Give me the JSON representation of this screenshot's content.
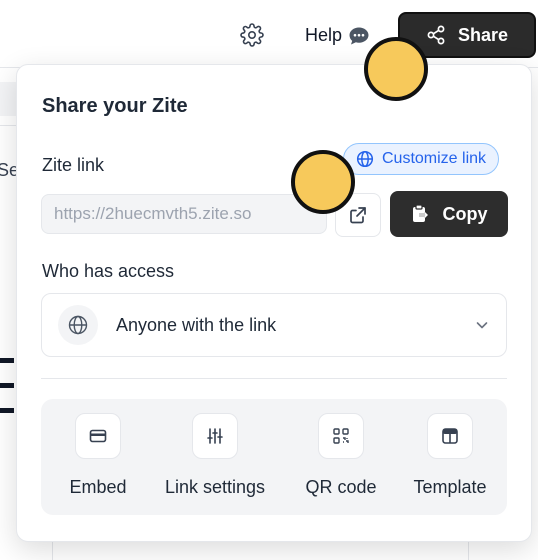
{
  "topbar": {
    "help_label": "Help",
    "share_label": "Share"
  },
  "background": {
    "fragment_text": "Se"
  },
  "share_panel": {
    "title": "Share your Zite",
    "link_section": {
      "label": "Zite link",
      "customize_label": "Customize link",
      "url_placeholder": "https://2huecmvth5.zite.so",
      "copy_label": "Copy"
    },
    "access_section": {
      "label": "Who has access",
      "selected_option": "Anyone with the link"
    },
    "options": [
      {
        "label": "Embed",
        "icon": "embed-icon"
      },
      {
        "label": "Link settings",
        "icon": "sliders-icon"
      },
      {
        "label": "QR code",
        "icon": "qr-code-icon"
      },
      {
        "label": "Template",
        "icon": "template-icon"
      }
    ]
  },
  "colors": {
    "accent_blue": "#2563eb",
    "dark_button": "#2d2d2d",
    "marker_yellow": "#f7c95b"
  }
}
